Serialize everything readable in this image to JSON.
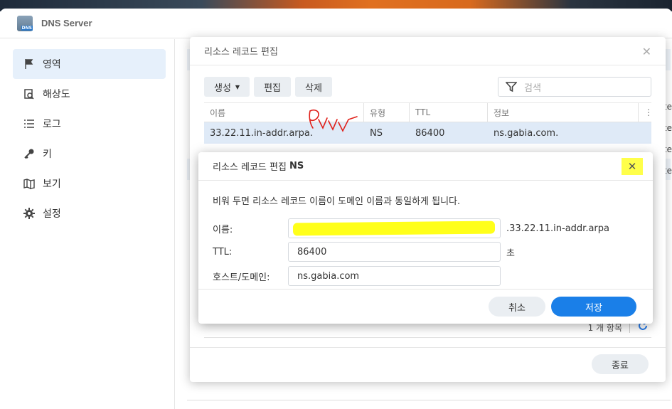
{
  "app": {
    "title": "DNS Server"
  },
  "sidebar": {
    "items": [
      {
        "label": "영역",
        "icon": "flag-icon",
        "active": true
      },
      {
        "label": "해상도",
        "icon": "resolve-icon",
        "active": false
      },
      {
        "label": "로그",
        "icon": "list-icon",
        "active": false
      },
      {
        "label": "키",
        "icon": "key-icon",
        "active": false
      },
      {
        "label": "보기",
        "icon": "map-icon",
        "active": false
      },
      {
        "label": "설정",
        "icon": "gear-icon",
        "active": false
      }
    ]
  },
  "background": {
    "right_edge_text": [
      "te",
      "te",
      "te",
      "te"
    ]
  },
  "rr_dialog": {
    "title": "리소스 레코드 편집",
    "toolbar": {
      "create_label": "생성",
      "edit_label": "편집",
      "delete_label": "삭제"
    },
    "search": {
      "placeholder": "검색"
    },
    "columns": [
      "이름",
      "유형",
      "TTL",
      "정보"
    ],
    "rows": [
      {
        "name": "33.22.11.in-addr.arpa.",
        "type": "NS",
        "ttl": "86400",
        "info": "ns.gabia.com."
      }
    ],
    "pager": {
      "count_label": "1 개 항목"
    },
    "close_label": "종료"
  },
  "ns_dialog": {
    "title_prefix": "리소스 레코드 편집",
    "title_type": "NS",
    "description": "비워 두면 리소스 레코드 이름이 도메인 이름과 동일하게 됩니다.",
    "fields": {
      "name": {
        "label": "이름:",
        "value": "",
        "suffix": ".33.22.11.in-addr.arpa"
      },
      "ttl": {
        "label": "TTL:",
        "value": "86400",
        "suffix": "초"
      },
      "host": {
        "label": "호스트/도메인:",
        "value": "ns.gabia.com"
      }
    },
    "cancel_label": "취소",
    "save_label": "저장"
  },
  "colors": {
    "accent": "#1a7fe8",
    "highlight": "#ffff1a",
    "selected_row": "#dfeaf7"
  }
}
